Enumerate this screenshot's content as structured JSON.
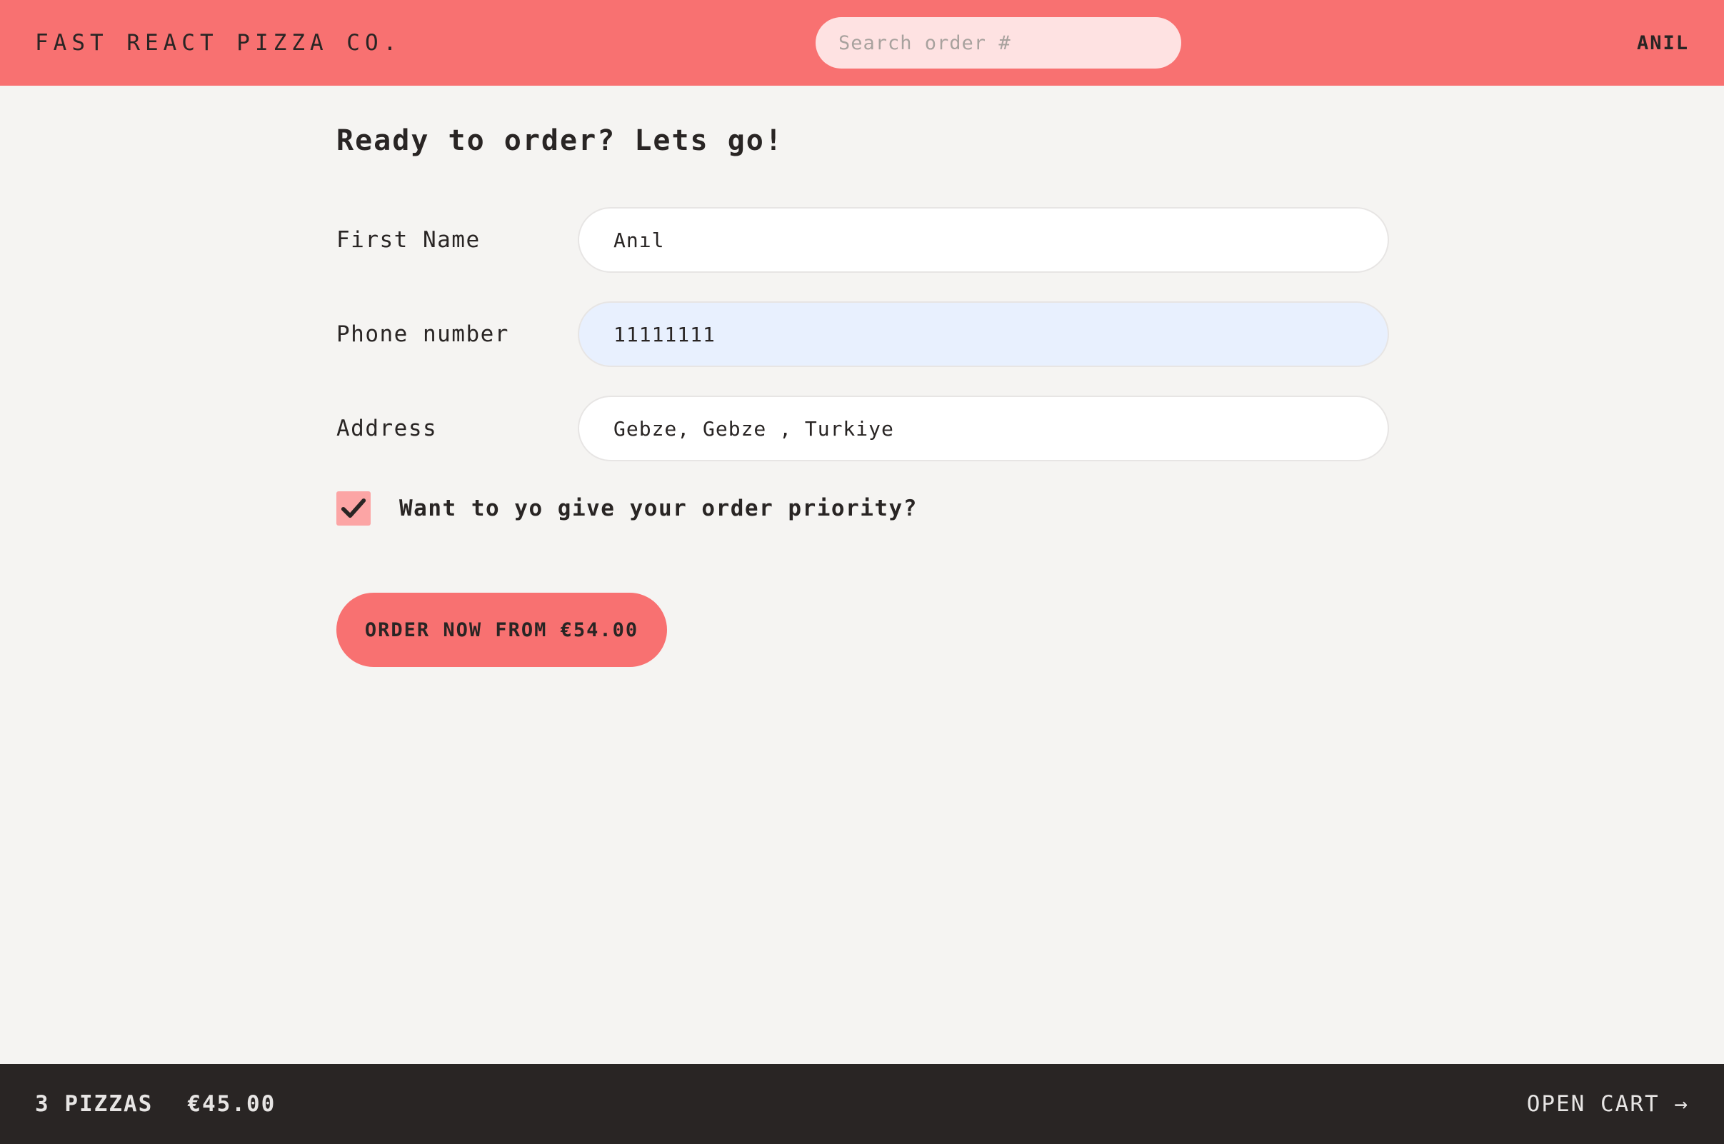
{
  "header": {
    "brand": "FAST REACT PIZZA CO.",
    "search_placeholder": "Search order #",
    "username": "ANIL"
  },
  "form": {
    "title": "Ready to order? Lets go!",
    "fields": [
      {
        "label": "First Name",
        "value": "Anıl"
      },
      {
        "label": "Phone number",
        "value": "11111111"
      },
      {
        "label": "Address",
        "value": "Gebze, Gebze , Turkiye"
      }
    ],
    "priority_label": "Want to yo give your order priority?",
    "priority_checked": true,
    "submit_label": "ORDER NOW FROM €54.00"
  },
  "cart": {
    "pizza_count": "3 PIZZAS",
    "total": "€45.00",
    "open_label": "OPEN CART →"
  },
  "colors": {
    "header_bg": "#f87171",
    "search_bg": "#fee2e2",
    "page_bg": "#f5f4f2",
    "checkbox_bg": "#fca5a5",
    "footer_bg": "#292524",
    "autofill_bg": "#e8f0fe"
  }
}
